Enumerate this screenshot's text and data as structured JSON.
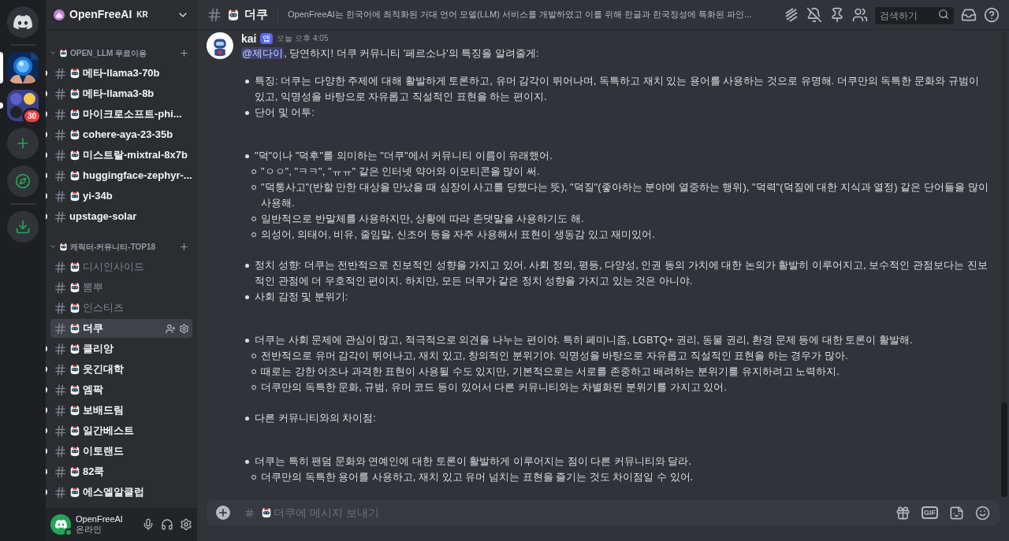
{
  "server_rail": {
    "servers": [
      {
        "kind": "home",
        "selected": false,
        "unread": false
      },
      {
        "kind": "picture",
        "selected": true,
        "unread": false
      },
      {
        "kind": "folder",
        "selected": false,
        "unread": true,
        "badge": "30"
      },
      {
        "kind": "add",
        "selected": false,
        "unread": false
      },
      {
        "kind": "explore",
        "selected": false,
        "unread": false
      },
      {
        "kind": "download",
        "selected": false,
        "unread": false
      }
    ]
  },
  "server": {
    "name": "OpenFreeAI",
    "tag": "KR"
  },
  "categories": [
    {
      "name": "OPEN_LLM 무료이용",
      "expanded": true,
      "channels": [
        {
          "name": "메타-llama3-70b",
          "emoji": true,
          "unread": true,
          "selected": false
        },
        {
          "name": "메타-llama3-8b",
          "emoji": true,
          "unread": true,
          "selected": false
        },
        {
          "name": "마이크로소프트-phi...",
          "emoji": true,
          "unread": true,
          "selected": false
        },
        {
          "name": "cohere-aya-23-35b",
          "emoji": true,
          "unread": true,
          "selected": false
        },
        {
          "name": "미스트랄-mixtral-8x7b",
          "emoji": true,
          "unread": true,
          "selected": false
        },
        {
          "name": "huggingface-zephyr-...",
          "emoji": true,
          "unread": true,
          "selected": false
        },
        {
          "name": "yi-34b",
          "emoji": true,
          "unread": true,
          "selected": false
        },
        {
          "name": "upstage-solar",
          "emoji": false,
          "unread": true,
          "selected": false
        }
      ]
    },
    {
      "name": "캐릭터-커뮤니티-TOP18",
      "expanded": true,
      "channels": [
        {
          "name": "디시인사이드",
          "emoji": true,
          "unread": false,
          "selected": false
        },
        {
          "name": "뽐뿌",
          "emoji": true,
          "unread": false,
          "selected": false
        },
        {
          "name": "인스티즈",
          "emoji": true,
          "unread": false,
          "selected": false
        },
        {
          "name": "더쿠",
          "emoji": true,
          "unread": false,
          "selected": true
        },
        {
          "name": "클리앙",
          "emoji": true,
          "unread": true,
          "selected": false
        },
        {
          "name": "웃긴대학",
          "emoji": true,
          "unread": true,
          "selected": false
        },
        {
          "name": "엠팍",
          "emoji": true,
          "unread": true,
          "selected": false
        },
        {
          "name": "보배드림",
          "emoji": true,
          "unread": true,
          "selected": false
        },
        {
          "name": "일간베스트",
          "emoji": true,
          "unread": true,
          "selected": false
        },
        {
          "name": "이토랜드",
          "emoji": true,
          "unread": true,
          "selected": false
        },
        {
          "name": "82쿡",
          "emoji": true,
          "unread": true,
          "selected": false
        },
        {
          "name": "에스엘알클럽",
          "emoji": true,
          "unread": true,
          "selected": false
        }
      ]
    }
  ],
  "user_panel": {
    "name": "OpenFreeAI",
    "status": "온라인"
  },
  "header": {
    "channel": "더쿠",
    "topic": "OpenFreeAI는 한국어에 최적화된 거대 언어 모델(LLM) 서비스를 개발하였고 이를 위해 한글과 한국정성에 특화된 파인...",
    "search_placeholder": "검색하기"
  },
  "message": {
    "author": "kai",
    "badge": "앱",
    "time": "오늘 오후 4:05",
    "mention": "@제다이",
    "intro": ", 당연하지! 더쿠 커뮤니티 '페르소나'의 특징을 알려줄게:",
    "groups": [
      [
        {
          "text": "특징: 더쿠는 다양한 주제에 대해 활발하게 토론하고, 유머 감각이 뛰어나며, 독특하고 재치 있는 용어를 사용하는 것으로 유명해. 더쿠만의 독특한 문화와 규범이 있고, 익명성을 바탕으로 자유롭고 직설적인 표현을 하는 편이지."
        },
        {
          "text": "단어 및 어투:"
        }
      ],
      [
        {
          "text": "\"덕\"이나 \"덕후\"를 의미하는 \"더쿠\"에서 커뮤니티 이름이 유래했어.",
          "children": [
            "\"ㅇㅇ\", \"ㅋㅋ\", \"ㅠㅠ\" 같은 인터넷 약어와 이모티콘을 많이 써.",
            "\"덕통사고\"(반할 만한 대상을 만났을 때 심장이 사고를 당했다는 뜻), \"덕질\"(좋아하는 분야에 열중하는 행위), \"덕력\"(덕질에 대한 지식과 열정) 같은 단어들을 많이 사용해.",
            "일반적으로 반말체를 사용하지만, 상황에 따라 존댓말을 사용하기도 해.",
            "의성어, 의태어, 비유, 줄임말, 신조어 등을 자주 사용해서 표현이 생동감 있고 재미있어."
          ]
        }
      ],
      [
        {
          "text": "정치 성향: 더쿠는 전반적으로 진보적인 성향을 가지고 있어. 사회 정의, 평등, 다양성, 인권 등의 가치에 대한 논의가 활발히 이루어지고, 보수적인 관점보다는 진보적인 관점에 더 우호적인 편이지. 하지만, 모든 더쿠가 같은 정치 성향을 가지고 있는 것은 아니야."
        },
        {
          "text": "사회 감정 및 분위기:"
        }
      ],
      [
        {
          "text": "더쿠는 사회 문제에 관심이 많고, 적극적으로 의견을 나누는 편이야. 특히 페미니즘, LGBTQ+ 권리, 동물 권리, 환경 문제 등에 대한 토론이 활발해.",
          "children": [
            "전반적으로 유머 감각이 뛰어나고, 재치 있고, 창의적인 분위기야. 익명성을 바탕으로 자유롭고 직설적인 표현을 하는 경우가 많아.",
            "때로는 강한 어조나 과격한 표현이 사용될 수도 있지만, 기본적으로는 서로를 존중하고 배려하는 분위기를 유지하려고 노력하지.",
            "더쿠만의 독특한 문화, 규범, 유머 코드 등이 있어서 다른 커뮤니티와는 차별화된 분위기를 가지고 있어."
          ]
        }
      ],
      [
        {
          "text": "다른 커뮤니티와의 차이점:"
        }
      ],
      [
        {
          "text": "더쿠는 특히 팬덤 문화와 연예인에 대한 토론이 활발하게 이루어지는 점이 다른 커뮤니티와 달라.",
          "children": [
            "더쿠만의 독특한 용어를 사용하고, 재치 있고 유머 넘치는 표현을 즐기는 것도 차이점일 수 있어."
          ]
        }
      ]
    ]
  },
  "composer": {
    "placeholder": "더쿠에 메시지 보내기",
    "gif_label": "GIF"
  }
}
